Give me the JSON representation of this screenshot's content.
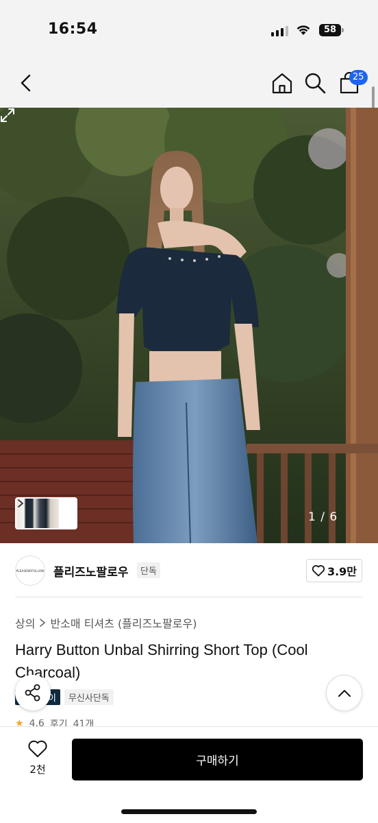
{
  "status_bar": {
    "time": "16:54",
    "battery": "58",
    "signal_icon": "cellular-signal-icon",
    "wifi_icon": "wifi-icon"
  },
  "header": {
    "back_icon": "chevron-left-icon",
    "home_icon": "home-icon",
    "search_icon": "search-icon",
    "cart_icon": "shopping-bag-icon",
    "cart_count": "25",
    "badge_color": "#1e64f0"
  },
  "gallery": {
    "counter": "1 / 6",
    "expand_icon": "expand-icon",
    "thumb_arrow_icon": "chevron-right-icon"
  },
  "brand": {
    "logo_text": "PLEASENOFOLLOW",
    "name": "플리즈노팔로우",
    "tag": "단독",
    "like_icon": "heart-outline-icon",
    "likes": "3.9만"
  },
  "product": {
    "breadcrumb": [
      "상의",
      "반소매 티셔츠 (플리즈노팔로우)"
    ],
    "title": "Harry Button Unbal Shirring Short Top (Cool Charcoal)",
    "tags": [
      "이",
      "무신사단독"
    ],
    "rating": "4.6",
    "review_label": "후기",
    "review_count": "41개"
  },
  "fabs": {
    "share_icon": "share-icon",
    "top_icon": "chevron-up-icon"
  },
  "bottom_bar": {
    "wish_icon": "heart-outline-icon",
    "wish_count": "2천",
    "buy_label": "구매하기",
    "buy_color": "#000000"
  }
}
